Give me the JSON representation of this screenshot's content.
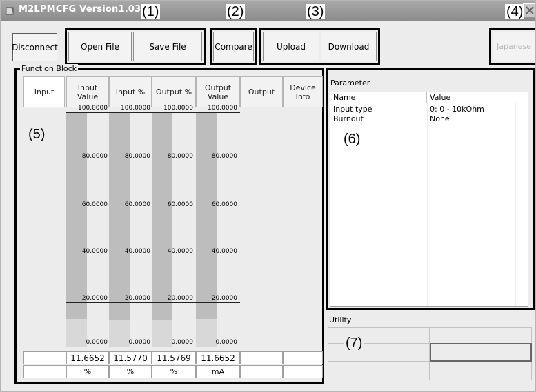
{
  "window": {
    "title": "M2LPMCFG Version1.03",
    "close_icon": "close-icon"
  },
  "callouts": [
    "(1)",
    "(2)",
    "(3)",
    "(4)",
    "(5)",
    "(6)",
    "(7)"
  ],
  "toolbar": {
    "disconnect_label": "Disconnect",
    "open_file_label": "Open File",
    "save_file_label": "Save File",
    "compare_label": "Compare",
    "upload_label": "Upload",
    "download_label": "Download",
    "language_label": "Japanese"
  },
  "function_block": {
    "title": "Function Block",
    "headers": [
      "Input",
      "Input\nValue",
      "Input %",
      "Output %",
      "Output\nValue",
      "Output",
      "Device\nInfo"
    ],
    "scale_labels": [
      "100.0000",
      "80.0000",
      "60.0000",
      "40.0000",
      "20.0000",
      "0.0000"
    ],
    "values": [
      "",
      "11.6652",
      "11.5770",
      "11.5769",
      "11.6652",
      "",
      ""
    ],
    "units": [
      "",
      "%",
      "%",
      "%",
      "mA",
      "",
      ""
    ],
    "bar_levels_percent": [
      11.6652,
      11.577,
      11.5769,
      11.6652
    ]
  },
  "parameter": {
    "title": "Parameter",
    "columns": [
      "Name",
      "Value"
    ],
    "rows": [
      {
        "name": "Input type",
        "value": "0: 0 - 10kOhm"
      },
      {
        "name": "Burnout",
        "value": "None"
      }
    ]
  },
  "utility": {
    "title": "Utility"
  }
}
